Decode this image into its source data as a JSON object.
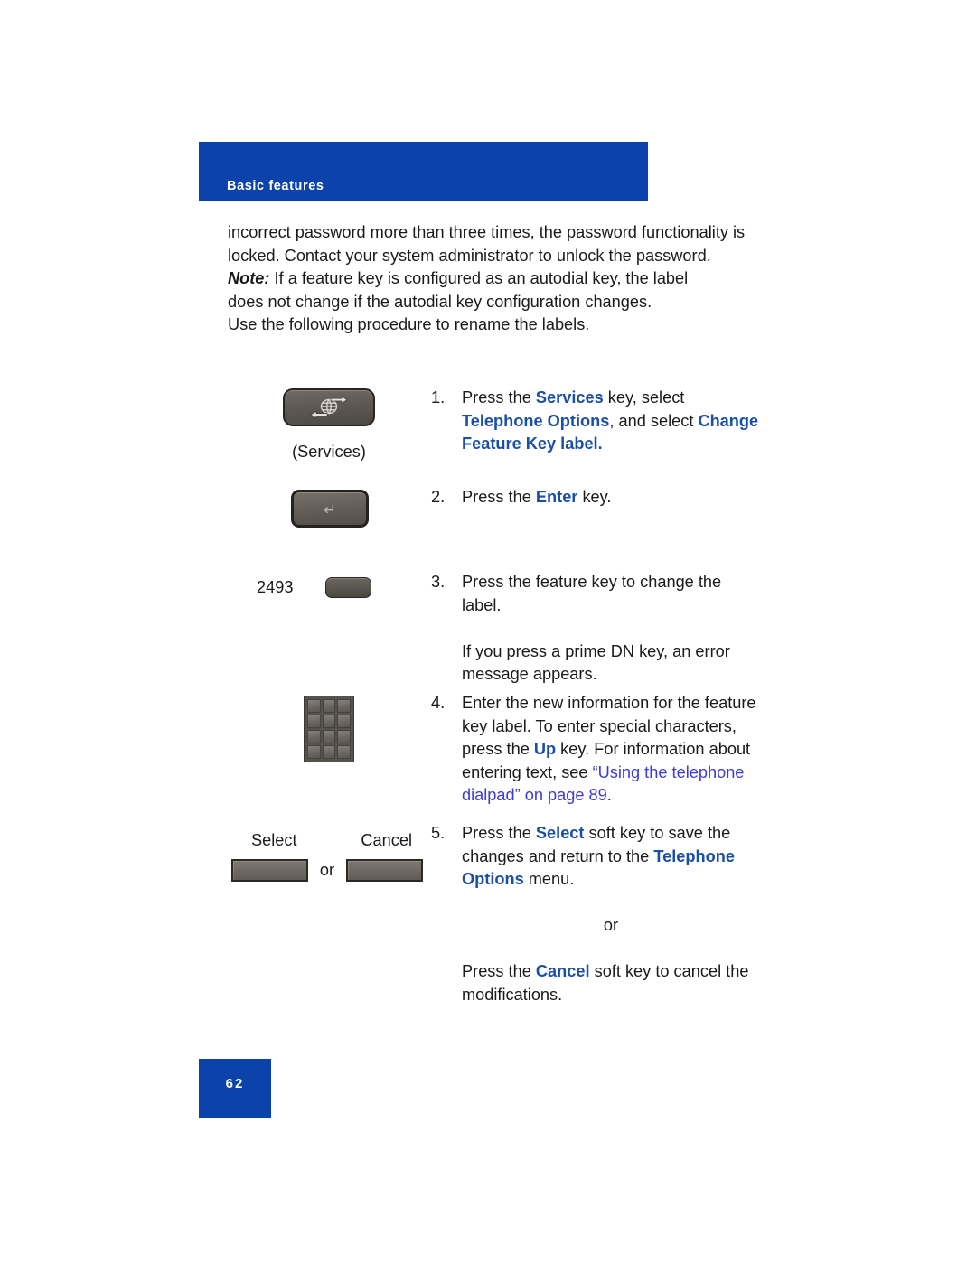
{
  "header": {
    "title": "Basic features"
  },
  "body": {
    "intro": "incorrect password more than three times, the password functionality is locked. Contact your system administrator to unlock the password.",
    "note_label": "Note:",
    "note_text": " If a feature key is configured as an autodial key, the label does not change if the autodial key configuration changes.",
    "procedure_intro": "Use the following procedure to rename the labels."
  },
  "steps": [
    {
      "number": "1.",
      "art": {
        "key_icon": "services-globe-icon",
        "caption": "(Services)"
      },
      "text": {
        "p1_a": "Press the ",
        "p1_b": "Services",
        "p1_c": " key, select ",
        "p1_d": "Telephone Options",
        "p1_e": ", and select ",
        "p1_f": "Change Feature Key label."
      }
    },
    {
      "number": "2.",
      "art": {
        "key_icon": "enter-return-icon",
        "glyph": "↵"
      },
      "text": {
        "p1_a": "Press the ",
        "p1_b": "Enter",
        "p1_c": " key."
      }
    },
    {
      "number": "3.",
      "art": {
        "key_icon": "feature-key-icon",
        "number_label": "2493"
      },
      "text": {
        "p1": "Press the feature key to change the label.",
        "p2": "If you press a prime DN key, an error message appears."
      }
    },
    {
      "number": "4.",
      "art": {
        "key_icon": "dialpad-icon"
      },
      "text": {
        "p1_a": "Enter the new information for the feature key label. To enter special characters, press the ",
        "p1_b": "Up",
        "p1_c": " key. For information about entering text, see ",
        "p1_xref": "“Using the telephone dialpad” on page 89",
        "p1_d": "."
      }
    },
    {
      "number": "5.",
      "art": {
        "select_label": "Select",
        "cancel_label": "Cancel",
        "or_label": "or",
        "select_key_icon": "select-soft-key-icon",
        "cancel_key_icon": "cancel-soft-key-icon"
      },
      "text": {
        "p1_a": "Press the ",
        "p1_b": "Select",
        "p1_c": " soft key to save the changes and return to the ",
        "p1_d": "Telephone Options",
        "p1_e": " menu.",
        "p2_or": "or",
        "p3_a": "Press the ",
        "p3_b": "Cancel",
        "p3_c": " soft key to cancel the modifications."
      }
    }
  ],
  "footer": {
    "page_number": "62"
  },
  "colors": {
    "banner_blue": "#0b43ab",
    "accent_blue": "#1a4fa8",
    "xref_blue": "#3b3bd6",
    "body_text": "#1a1a1a"
  }
}
